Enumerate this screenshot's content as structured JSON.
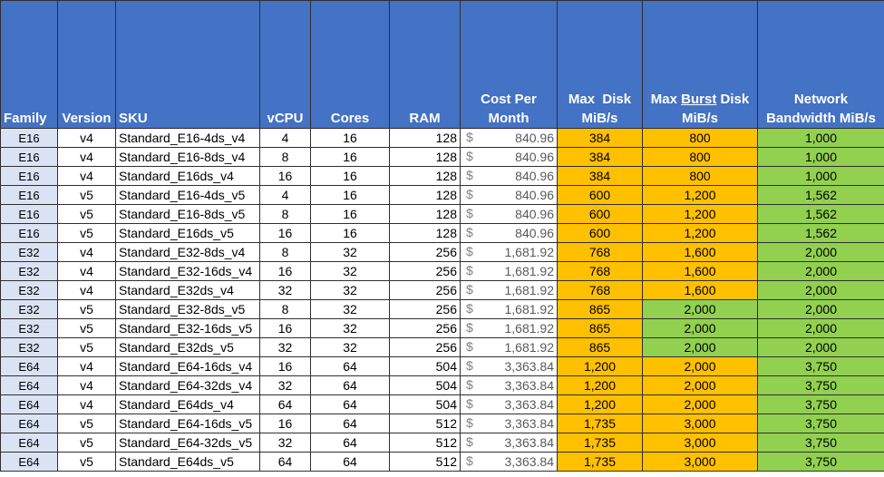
{
  "headers": {
    "family": "Family",
    "version": "Version",
    "sku": "SKU",
    "vcpu": "vCPU",
    "cores": "Cores",
    "ram": "RAM",
    "cost_line1": "Cost Per",
    "cost_line2": "Month",
    "maxdisk_line1": "Max  Disk",
    "maxdisk_line2": "MiB/s",
    "burst_pre": "Max ",
    "burst_word": "Burst",
    "burst_post": " Disk",
    "burst_line2": "MiB/s",
    "network_line1": "Network",
    "network_line2": "Bandwidth MiB/s"
  },
  "currency_symbol": "$",
  "colors": {
    "header_bg": "#4472c4",
    "family_bg": "#dae3f3",
    "orange": "#ffc000",
    "green": "#92d050"
  },
  "rows": [
    {
      "family": "E16",
      "version": "v4",
      "sku": "Standard_E16-4ds_v4",
      "vcpu": "4",
      "cores": "16",
      "ram": "128",
      "cost": "840.96",
      "max_disk": "384",
      "burst": "800",
      "burst_color": "orange",
      "network": "1,000"
    },
    {
      "family": "E16",
      "version": "v4",
      "sku": "Standard_E16-8ds_v4",
      "vcpu": "8",
      "cores": "16",
      "ram": "128",
      "cost": "840.96",
      "max_disk": "384",
      "burst": "800",
      "burst_color": "orange",
      "network": "1,000"
    },
    {
      "family": "E16",
      "version": "v4",
      "sku": "Standard_E16ds_v4",
      "vcpu": "16",
      "cores": "16",
      "ram": "128",
      "cost": "840.96",
      "max_disk": "384",
      "burst": "800",
      "burst_color": "orange",
      "network": "1,000"
    },
    {
      "family": "E16",
      "version": "v5",
      "sku": "Standard_E16-4ds_v5",
      "vcpu": "4",
      "cores": "16",
      "ram": "128",
      "cost": "840.96",
      "max_disk": "600",
      "burst": "1,200",
      "burst_color": "orange",
      "network": "1,562"
    },
    {
      "family": "E16",
      "version": "v5",
      "sku": "Standard_E16-8ds_v5",
      "vcpu": "8",
      "cores": "16",
      "ram": "128",
      "cost": "840.96",
      "max_disk": "600",
      "burst": "1,200",
      "burst_color": "orange",
      "network": "1,562"
    },
    {
      "family": "E16",
      "version": "v5",
      "sku": "Standard_E16ds_v5",
      "vcpu": "16",
      "cores": "16",
      "ram": "128",
      "cost": "840.96",
      "max_disk": "600",
      "burst": "1,200",
      "burst_color": "orange",
      "network": "1,562"
    },
    {
      "family": "E32",
      "version": "v4",
      "sku": "Standard_E32-8ds_v4",
      "vcpu": "8",
      "cores": "32",
      "ram": "256",
      "cost": "1,681.92",
      "max_disk": "768",
      "burst": "1,600",
      "burst_color": "orange",
      "network": "2,000"
    },
    {
      "family": "E32",
      "version": "v4",
      "sku": "Standard_E32-16ds_v4",
      "vcpu": "16",
      "cores": "32",
      "ram": "256",
      "cost": "1,681.92",
      "max_disk": "768",
      "burst": "1,600",
      "burst_color": "orange",
      "network": "2,000"
    },
    {
      "family": "E32",
      "version": "v4",
      "sku": "Standard_E32ds_v4",
      "vcpu": "32",
      "cores": "32",
      "ram": "256",
      "cost": "1,681.92",
      "max_disk": "768",
      "burst": "1,600",
      "burst_color": "orange",
      "network": "2,000"
    },
    {
      "family": "E32",
      "version": "v5",
      "sku": "Standard_E32-8ds_v5",
      "vcpu": "8",
      "cores": "32",
      "ram": "256",
      "cost": "1,681.92",
      "max_disk": "865",
      "burst": "2,000",
      "burst_color": "green",
      "network": "2,000"
    },
    {
      "family": "E32",
      "version": "v5",
      "sku": "Standard_E32-16ds_v5",
      "vcpu": "16",
      "cores": "32",
      "ram": "256",
      "cost": "1,681.92",
      "max_disk": "865",
      "burst": "2,000",
      "burst_color": "green",
      "network": "2,000"
    },
    {
      "family": "E32",
      "version": "v5",
      "sku": "Standard_E32ds_v5",
      "vcpu": "32",
      "cores": "32",
      "ram": "256",
      "cost": "1,681.92",
      "max_disk": "865",
      "burst": "2,000",
      "burst_color": "green",
      "network": "2,000"
    },
    {
      "family": "E64",
      "version": "v4",
      "sku": "Standard_E64-16ds_v4",
      "vcpu": "16",
      "cores": "64",
      "ram": "504",
      "cost": "3,363.84",
      "max_disk": "1,200",
      "burst": "2,000",
      "burst_color": "orange",
      "network": "3,750"
    },
    {
      "family": "E64",
      "version": "v4",
      "sku": "Standard_E64-32ds_v4",
      "vcpu": "32",
      "cores": "64",
      "ram": "504",
      "cost": "3,363.84",
      "max_disk": "1,200",
      "burst": "2,000",
      "burst_color": "orange",
      "network": "3,750"
    },
    {
      "family": "E64",
      "version": "v4",
      "sku": "Standard_E64ds_v4",
      "vcpu": "64",
      "cores": "64",
      "ram": "504",
      "cost": "3,363.84",
      "max_disk": "1,200",
      "burst": "2,000",
      "burst_color": "orange",
      "network": "3,750"
    },
    {
      "family": "E64",
      "version": "v5",
      "sku": "Standard_E64-16ds_v5",
      "vcpu": "16",
      "cores": "64",
      "ram": "512",
      "cost": "3,363.84",
      "max_disk": "1,735",
      "burst": "3,000",
      "burst_color": "orange",
      "network": "3,750"
    },
    {
      "family": "E64",
      "version": "v5",
      "sku": "Standard_E64-32ds_v5",
      "vcpu": "32",
      "cores": "64",
      "ram": "512",
      "cost": "3,363.84",
      "max_disk": "1,735",
      "burst": "3,000",
      "burst_color": "orange",
      "network": "3,750"
    },
    {
      "family": "E64",
      "version": "v5",
      "sku": "Standard_E64ds_v5",
      "vcpu": "64",
      "cores": "64",
      "ram": "512",
      "cost": "3,363.84",
      "max_disk": "1,735",
      "burst": "3,000",
      "burst_color": "orange",
      "network": "3,750"
    }
  ]
}
